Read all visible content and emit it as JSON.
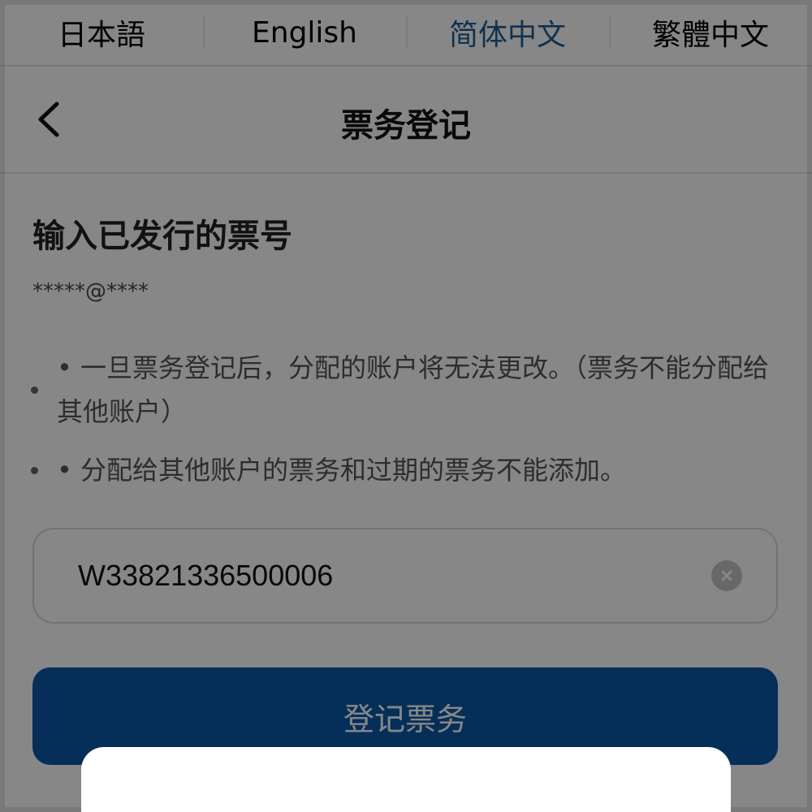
{
  "languages": [
    {
      "label": "日本語",
      "active": false
    },
    {
      "label": "English",
      "active": false
    },
    {
      "label": "简体中文",
      "active": true
    },
    {
      "label": "繁體中文",
      "active": false
    }
  ],
  "header": {
    "back_icon": "chevron-left-icon",
    "title": "票务登记"
  },
  "main": {
    "section_title": "输入已发行的票号",
    "masked_email": "*****@****",
    "notes": [
      "• 一旦票务登记后，分配的账户将无法更改。（票务不能分配给其他账户）",
      "• 分配给其他账户的票务和过期的票务不能添加。"
    ],
    "ticket_input": {
      "value": "W33821336500006",
      "clear_icon": "clear-circle-icon"
    },
    "register_button_label": "登记票务"
  },
  "colors": {
    "accent": "#1f5f94",
    "button": "#0b5aa8",
    "overlay": "rgba(0,0,0,0.47)"
  }
}
